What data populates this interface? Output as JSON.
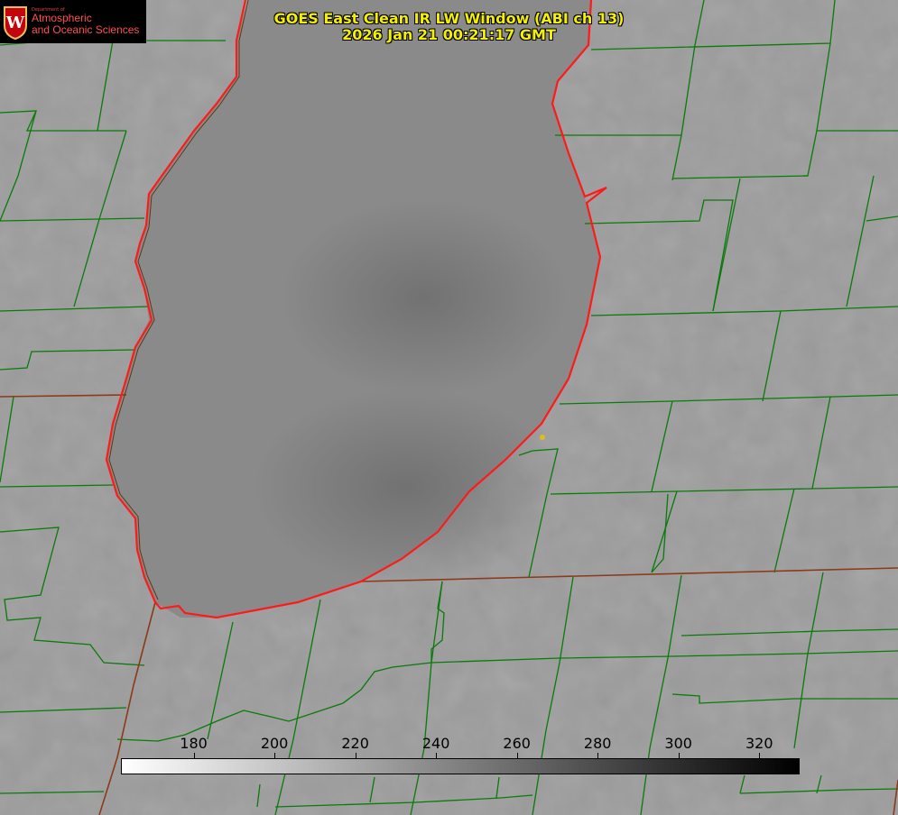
{
  "title": {
    "line1": "GOES East Clean IR LW Window (ABI ch 13)",
    "line2": "2026 Jan 21 00:21:17 GMT"
  },
  "logo": {
    "department": "Department of",
    "line1": "Atmospheric",
    "line2": "and Oceanic Sciences"
  },
  "colorbar": {
    "min": 162,
    "max": 330,
    "ticks": [
      "180",
      "200",
      "220",
      "240",
      "260",
      "280",
      "300",
      "320"
    ],
    "colors": [
      "#ffffff",
      "#000000"
    ]
  },
  "colors": {
    "county_lines": "#0a7a0a",
    "state_lines": "#8b3a1a",
    "shoreline_highlight": "#ff1a1a",
    "title_text": "#f4f000",
    "marker": "#d8c020"
  }
}
